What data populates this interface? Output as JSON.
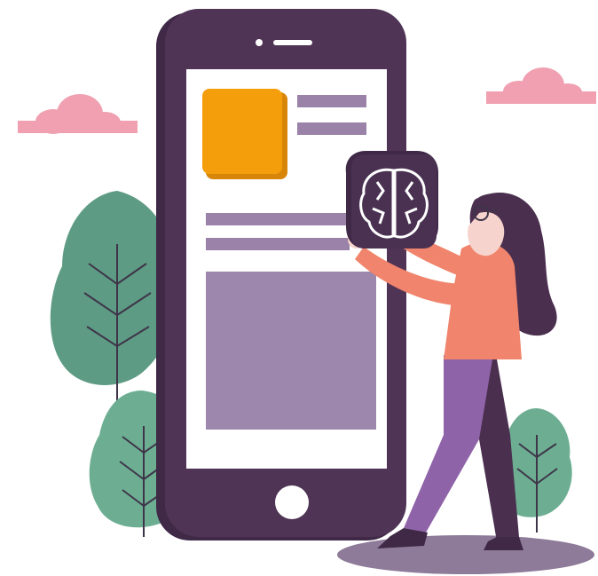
{
  "illustration": {
    "subject": "woman-holding-brain-app-icon-beside-smartphone",
    "colors": {
      "phone_body": "#4f3456",
      "phone_screen": "#ffffff",
      "orange_tile": "#f59e0b",
      "placeholder_bar": "#9b82a9",
      "content_block": "#9d87ad",
      "cloud": "#f0a0b0",
      "tree": "#5e9b84",
      "tree_light": "#6dae93",
      "shadow_ellipse": "#8e7a99",
      "brain_tile": "#4a3152",
      "sweater": "#f0846c",
      "pants": "#8f63a8",
      "hair": "#4a2f4f",
      "skin": "#f6d3cc"
    },
    "icons": [
      "brain-icon",
      "home-button-icon",
      "phone-camera-icon",
      "phone-speaker-icon"
    ]
  }
}
